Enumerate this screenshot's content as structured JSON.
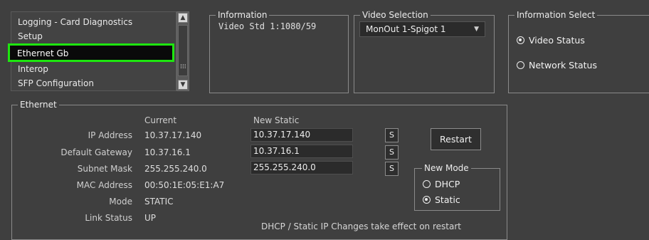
{
  "menu_list": {
    "items": [
      {
        "label": "Logging - Card Diagnostics",
        "selected": false
      },
      {
        "label": "Setup",
        "selected": false
      },
      {
        "label": "Ethernet Gb",
        "selected": true
      },
      {
        "label": "Interop",
        "selected": false
      },
      {
        "label": "SFP Configuration",
        "selected": false
      }
    ],
    "scroll_up_icon": "up-arrow-icon",
    "scroll_down_icon": "down-arrow-icon",
    "grip_icon": "grip-dots-icon"
  },
  "information": {
    "title": "Information",
    "content": "Video Std 1:1080/59"
  },
  "video_selection": {
    "title": "Video Selection",
    "selected": "MonOut 1-Spigot 1",
    "caret_icon": "chevron-down-icon"
  },
  "information_select": {
    "title": "Information Select",
    "options": [
      {
        "label": "Video Status",
        "checked": true
      },
      {
        "label": "Network Status",
        "checked": false
      }
    ]
  },
  "ethernet": {
    "title": "Ethernet",
    "col_current": "Current",
    "col_new_static": "New Static",
    "rows": [
      {
        "label": "IP Address",
        "current": "10.37.17.140",
        "new": "10.37.17.140",
        "set_button": "S"
      },
      {
        "label": "Default Gateway",
        "current": "10.37.16.1",
        "new": "10.37.16.1",
        "set_button": "S"
      },
      {
        "label": "Subnet Mask",
        "current": "255.255.240.0",
        "new": "255.255.240.0",
        "set_button": "S"
      },
      {
        "label": "MAC Address",
        "current": "00:50:1E:05:E1:A7"
      },
      {
        "label": "Mode",
        "current": "STATIC"
      },
      {
        "label": "Link Status",
        "current": "UP"
      }
    ],
    "restart_label": "Restart",
    "new_mode": {
      "title": "New Mode",
      "options": [
        {
          "label": "DHCP",
          "checked": false
        },
        {
          "label": "Static",
          "checked": true
        }
      ]
    },
    "note": "DHCP / Static IP Changes take effect on restart"
  },
  "colors": {
    "background": "#3f3f3f",
    "selection_highlight": "#1ee60f",
    "selection_fill": "#0a0a0a",
    "field_fill": "#2b2b2b"
  }
}
